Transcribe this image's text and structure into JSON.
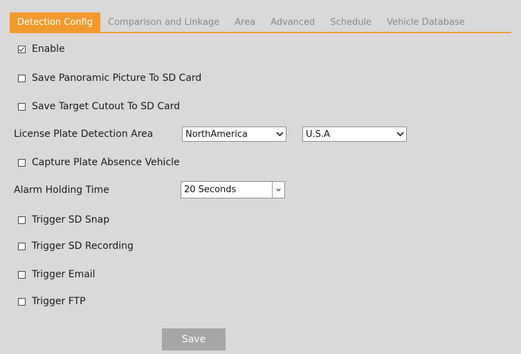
{
  "tabs": [
    {
      "label": "Detection Config",
      "active": true
    },
    {
      "label": "Comparison and Linkage",
      "active": false
    },
    {
      "label": "Area",
      "active": false
    },
    {
      "label": "Advanced",
      "active": false
    },
    {
      "label": "Schedule",
      "active": false
    },
    {
      "label": "Vehicle Database",
      "active": false
    }
  ],
  "options": {
    "enable": {
      "label": "Enable",
      "checked": true
    },
    "save_panoramic": {
      "label": "Save Panoramic Picture To SD Card",
      "checked": false
    },
    "save_cutout": {
      "label": "Save Target Cutout To SD Card",
      "checked": false
    },
    "capture_plate_absence": {
      "label": "Capture Plate Absence Vehicle",
      "checked": false
    },
    "trigger_sd_snap": {
      "label": "Trigger SD Snap",
      "checked": false
    },
    "trigger_sd_recording": {
      "label": "Trigger SD Recording",
      "checked": false
    },
    "trigger_email": {
      "label": "Trigger Email",
      "checked": false
    },
    "trigger_ftp": {
      "label": "Trigger FTP",
      "checked": false
    }
  },
  "plate_area": {
    "label": "License Plate Detection Area",
    "region": "NorthAmerica",
    "country": "U.S.A"
  },
  "alarm_holding": {
    "label": "Alarm Holding Time",
    "value": "20 Seconds"
  },
  "save_label": "Save",
  "colors": {
    "accent": "#f39a2e",
    "background": "#d9d9d9",
    "button": "#a6a6a6"
  }
}
